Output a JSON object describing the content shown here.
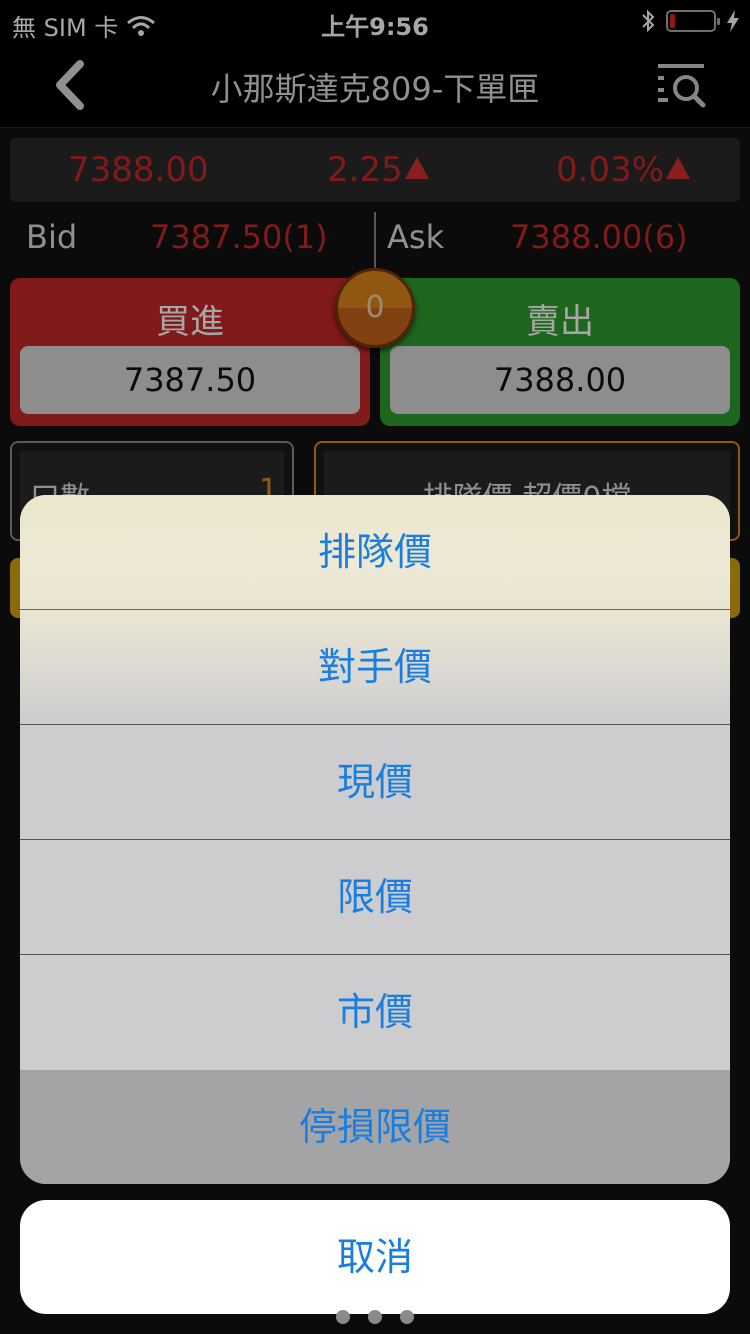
{
  "status_bar": {
    "carrier": "無 SIM 卡",
    "time": "上午9:56",
    "battery_level": 0.1,
    "icons": [
      "wifi-icon",
      "bluetooth-icon",
      "battery-icon",
      "charging-icon"
    ]
  },
  "nav": {
    "title": "小那斯達克809-下單匣",
    "left_icon": "chevron-left-icon",
    "right_icon": "search-list-icon"
  },
  "quote": {
    "last": "7388.00",
    "change": "2.25",
    "change_pct": "0.03%",
    "direction": "up",
    "color": "#c62828"
  },
  "bid_ask": {
    "bid_label": "Bid",
    "bid_value": "7387.50(1)",
    "ask_label": "Ask",
    "ask_value": "7388.00(6)"
  },
  "trade": {
    "buy_label": "買進",
    "buy_price": "7387.50",
    "sell_label": "賣出",
    "sell_price": "7388.00",
    "position_count": "0",
    "buy_color": "#c62828",
    "sell_color": "#2e9d2e"
  },
  "order": {
    "qty_label": "口數",
    "qty_value": "1",
    "price_type_text": "排隊價 超價0檔"
  },
  "action_sheet": {
    "options": [
      {
        "label": "排隊價"
      },
      {
        "label": "對手價"
      },
      {
        "label": "現價"
      },
      {
        "label": "限價"
      },
      {
        "label": "市價"
      },
      {
        "label": "停損限價"
      }
    ],
    "highlighted_index": 5,
    "cancel_label": "取消",
    "text_color": "#1a7ee0"
  },
  "pager": {
    "dots": 3
  }
}
